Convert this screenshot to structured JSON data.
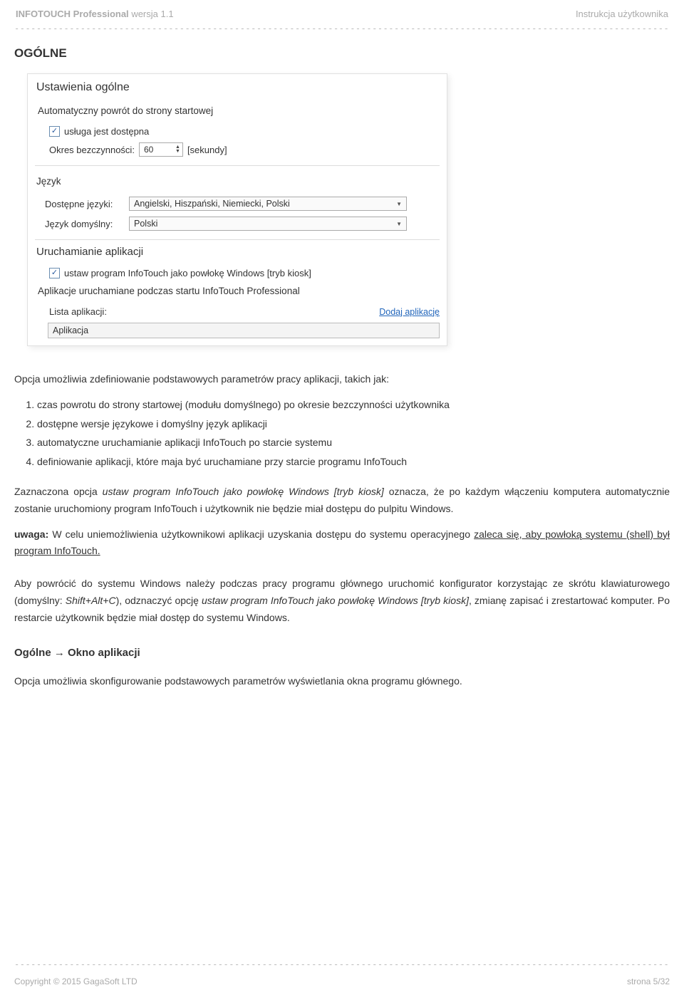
{
  "header": {
    "brand": "INFOTOUCH Professional",
    "version": "wersja 1.1",
    "right": "Instrukcja użytkownika",
    "dashes": "-----------------------------------------------------------------------------------------------------------------------------"
  },
  "section_title": "OGÓLNE",
  "settings": {
    "panel_title": "Ustawienia ogólne",
    "auto_return_title": "Automatyczny powrót do strony startowej",
    "service_available": "usługa jest dostępna",
    "idle_label": "Okres bezczynności:",
    "idle_value": "60",
    "idle_unit": "[sekundy]",
    "lang_title": "Język",
    "lang_available_label": "Dostępne języki:",
    "lang_available_value": "Angielski, Hiszpański, Niemiecki, Polski",
    "lang_default_label": "Język domyślny:",
    "lang_default_value": "Polski",
    "launch_title": "Uruchamianie aplikacji",
    "kiosk_label": "ustaw program InfoTouch jako powłokę Windows [tryb kiosk]",
    "startup_apps_title": "Aplikacje uruchamiane podczas startu InfoTouch Professional",
    "list_label": "Lista aplikacji:",
    "add_link": "Dodaj aplikację",
    "list_header": "Aplikacja"
  },
  "body": {
    "intro": "Opcja umożliwia zdefiniowanie podstawowych parametrów pracy aplikacji, takich jak:",
    "li1": "czas powrotu do strony startowej (modułu domyślnego) po okresie bezczynności użytkownika",
    "li2": "dostępne wersje językowe i domyślny język aplikacji",
    "li3": "automatyczne uruchamianie aplikacji InfoTouch po starcie systemu",
    "li4": "definiowanie aplikacji, które maja być uruchamiane przy starcie programu InfoTouch",
    "p2a": "Zaznaczona opcja ",
    "p2em": "ustaw program InfoTouch jako powłokę Windows [tryb kiosk]",
    "p2b": " oznacza, że po każdym włączeniu komputera automatycznie zostanie uruchomiony program InfoTouch i użytkownik nie będzie miał dostępu do pulpitu Windows.",
    "p3a": "uwaga:",
    "p3b": " W celu uniemożliwienia użytkownikowi aplikacji uzyskania dostępu do systemu operacyjnego ",
    "p3und": "zaleca się, aby powłoką systemu (shell) był program InfoTouch.",
    "p4a": "Aby powrócić do systemu Windows należy podczas pracy programu głównego uruchomić konfigurator korzystając ze skrótu klawiaturowego (domyślny: ",
    "p4em1": "Shift+Alt+C",
    "p4b": "), odznaczyć opcję ",
    "p4em2": "ustaw program InfoTouch jako powłokę Windows [tryb kiosk]",
    "p4c": ", zmianę zapisać i zrestartować komputer. Po restarcie użytkownik będzie miał dostęp do systemu Windows.",
    "subheading": "Ogólne → Okno aplikacji",
    "p5": "Opcja umożliwia skonfigurowanie podstawowych parametrów wyświetlania okna programu głównego."
  },
  "footer": {
    "left": "Copyright © 2015 GagaSoft LTD",
    "right": "strona 5/32",
    "dashes": "-----------------------------------------------------------------------------------------------------------------------------"
  }
}
